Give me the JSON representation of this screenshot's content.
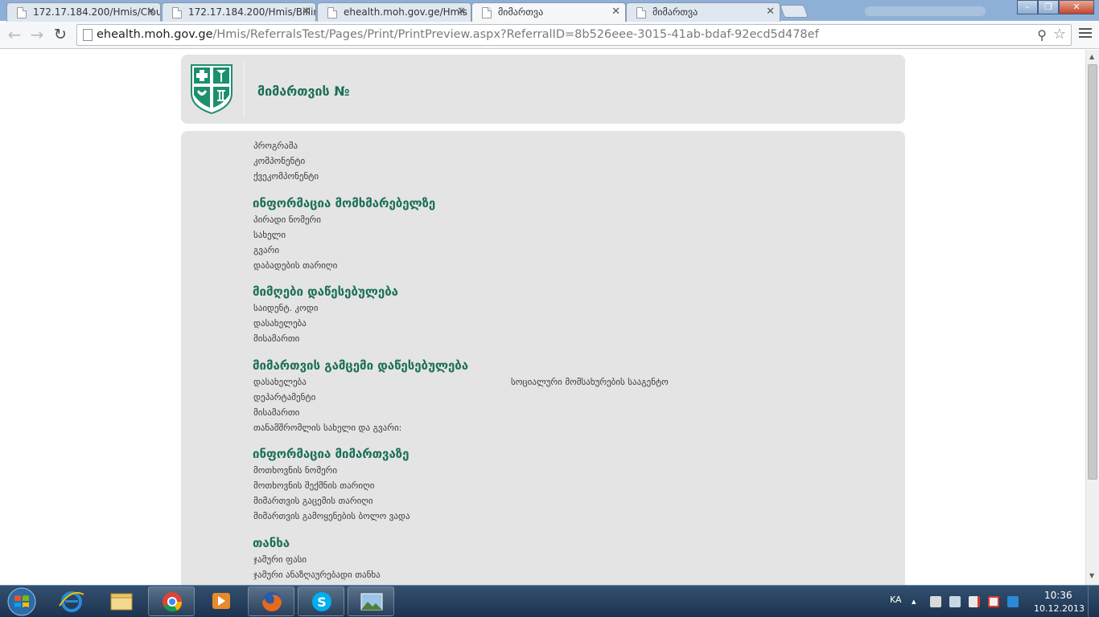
{
  "tabs": [
    {
      "title": "172.17.184.200/Hmis/Clou",
      "active": false
    },
    {
      "title": "172.17.184.200/Hmis/Billin",
      "active": false
    },
    {
      "title": "ehealth.moh.gov.ge/Hmis",
      "active": false
    },
    {
      "title": "მიმართვა",
      "active": true
    },
    {
      "title": "მიმართვა",
      "active": false
    }
  ],
  "address_bar": {
    "protocol_icon": "page-icon",
    "host": "ehealth.moh.gov.ge",
    "path": "/Hmis/ReferralsTest/Pages/Print/PrintPreview.aspx?ReferralID=8b526eee-3015-41ab-bdaf-92ecd5d478ef"
  },
  "page": {
    "header_title": "მიმართვის №",
    "fields_top": [
      "პროგრამა",
      "კომპონენტი",
      "ქვეკომპონენტი"
    ],
    "sections": [
      {
        "title": "ინფორმაცია მომხმარებელზე",
        "fields": [
          "პირადი ნომერი",
          "სახელი",
          "გვარი",
          "დაბადების თარიღი"
        ]
      },
      {
        "title": "მიმღები დაწესებულება",
        "fields": [
          "საიდენტ. კოდი",
          "დასახელება",
          "მისამართი"
        ]
      },
      {
        "title": "მიმართვის გამცემი დაწესებულება",
        "fields": [
          "დასახელება",
          "დეპარტამენტი",
          "მისამართი",
          "თანამშრომლის სახელი და გვარი:"
        ],
        "values": {
          "დასახელება": "სოციალური მომსახურების სააგენტო"
        }
      },
      {
        "title": "ინფორმაცია მიმართვაზე",
        "fields": [
          "მოთხოვნის ნომერი",
          "მოთხოვნის შექმნის თარიღი",
          "მიმართვის გაცემის თარიღი",
          "მიმართვის გამოყენების ბოლო ვადა"
        ]
      },
      {
        "title": "თანხა",
        "fields": [
          "ჯამური ფასი",
          "ჯამური ანაზღაურებადი თანხა"
        ]
      }
    ]
  },
  "taskbar": {
    "apps": [
      "start-orb",
      "internet-explorer-icon",
      "windows-explorer-icon",
      "chrome-icon",
      "media-player-icon",
      "firefox-icon",
      "skype-icon",
      "image-viewer-icon"
    ],
    "language": "KA",
    "time": "10:36",
    "date": "10.12.2013"
  },
  "colors": {
    "accent": "#1a6e57",
    "card_bg": "#e4e4e4",
    "tabstrip_bg": "#8fb0d6"
  }
}
